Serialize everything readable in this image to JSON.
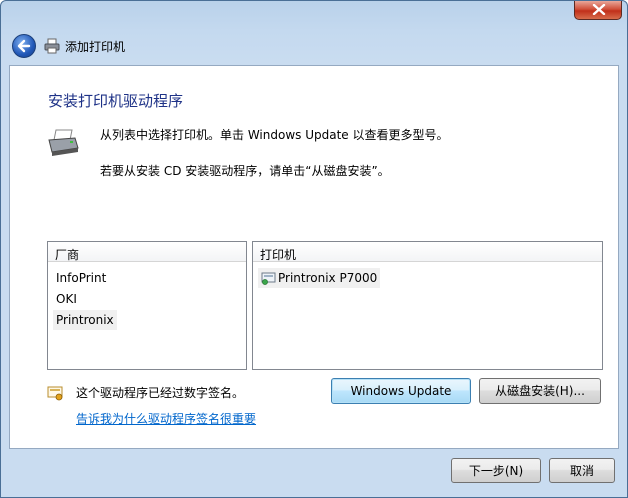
{
  "window": {
    "title": "添加打印机"
  },
  "page": {
    "heading": "安装打印机驱动程序",
    "intro_line1": "从列表中选择打印机。单击 Windows Update 以查看更多型号。",
    "intro_line2": "若要从安装 CD 安装驱动程序，请单击“从磁盘安装”。"
  },
  "manufacturers": {
    "header": "厂商",
    "items": [
      "InfoPrint",
      "OKI",
      "Printronix"
    ],
    "selected": "Printronix"
  },
  "printers": {
    "header": "打印机",
    "items": [
      "Printronix P7000"
    ],
    "selected": "Printronix P7000"
  },
  "signature": {
    "text": "这个驱动程序已经过数字签名。",
    "link": "告诉我为什么驱动程序签名很重要"
  },
  "buttons": {
    "windows_update": "Windows Update",
    "have_disk": "从磁盘安装(H)...",
    "next": "下一步(N)",
    "cancel": "取消"
  },
  "colors": {
    "heading": "#1e3287",
    "link": "#0066cc",
    "close_button": "#c1301a"
  }
}
